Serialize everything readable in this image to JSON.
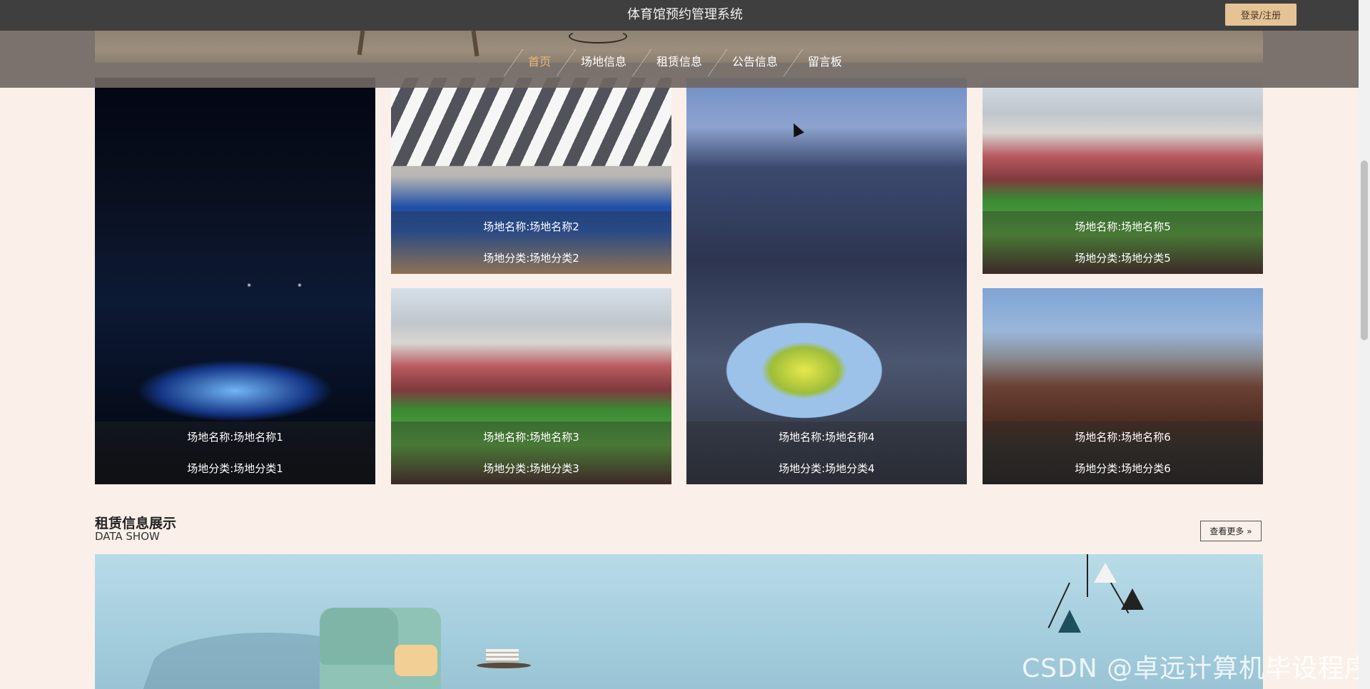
{
  "header": {
    "site_title": "体育馆预约管理系统",
    "login_label": "登录/注册"
  },
  "nav": {
    "items": [
      {
        "label": "首页",
        "active": true
      },
      {
        "label": "场地信息",
        "active": false
      },
      {
        "label": "租赁信息",
        "active": false
      },
      {
        "label": "公告信息",
        "active": false
      },
      {
        "label": "留言板",
        "active": false
      }
    ]
  },
  "venues": [
    {
      "name": "场地名称:场地名称1",
      "category": "场地分类:场地分类1"
    },
    {
      "name": "场地名称:场地名称2",
      "category": "场地分类:场地分类2"
    },
    {
      "name": "场地名称:场地名称3",
      "category": "场地分类:场地分类3"
    },
    {
      "name": "场地名称:场地名称4",
      "category": "场地分类:场地分类4"
    },
    {
      "name": "场地名称:场地名称5",
      "category": "场地分类:场地分类5"
    },
    {
      "name": "场地名称:场地名称6",
      "category": "场地分类:场地分类6"
    }
  ],
  "rental_section": {
    "title": "租赁信息展示",
    "subtitle": "DATA SHOW",
    "more_label": "查看更多 »"
  },
  "watermark": "CSDN @卓远计算机毕设程序",
  "colors": {
    "accent": "#e6b77a",
    "login_button": "#e4c495",
    "background": "#faf0e9",
    "topbar": "#3f3f3f"
  }
}
